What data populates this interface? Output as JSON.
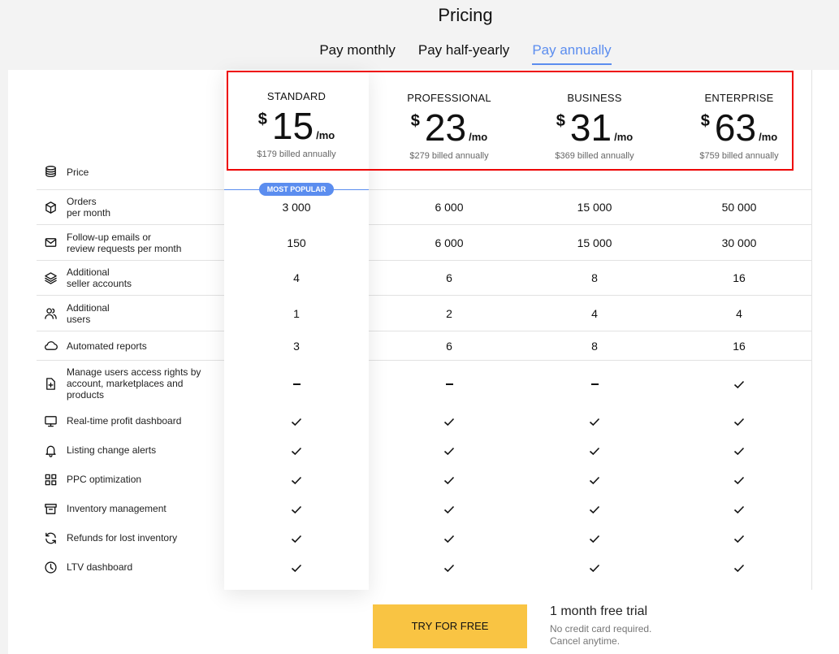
{
  "header": {
    "title": "Pricing",
    "tabs": [
      {
        "label": "Pay monthly",
        "active": false
      },
      {
        "label": "Pay half-yearly",
        "active": false
      },
      {
        "label": "Pay annually",
        "active": true
      }
    ]
  },
  "colors": {
    "accent": "#5b8def",
    "cta": "#f9c443",
    "highlight_border": "#ee0000"
  },
  "plans": [
    {
      "name": "STANDARD",
      "currency": "$",
      "price": "15",
      "per": "/mo",
      "billed": "$179 billed annually",
      "badge": "MOST POPULAR"
    },
    {
      "name": "PROFESSIONAL",
      "currency": "$",
      "price": "23",
      "per": "/mo",
      "billed": "$279 billed annually"
    },
    {
      "name": "BUSINESS",
      "currency": "$",
      "price": "31",
      "per": "/mo",
      "billed": "$369 billed annually"
    },
    {
      "name": "ENTERPRISE",
      "currency": "$",
      "price": "63",
      "per": "/mo",
      "billed": "$759 billed annually"
    }
  ],
  "features": [
    {
      "icon": "coins-icon",
      "label": "Price",
      "values": []
    },
    {
      "icon": "box-icon",
      "label": "Orders\nper month",
      "values": [
        "3 000",
        "6 000",
        "15 000",
        "50 000"
      ]
    },
    {
      "icon": "mail-icon",
      "label": "Follow-up emails or\nreview requests per month",
      "values": [
        "150",
        "6 000",
        "15 000",
        "30 000"
      ]
    },
    {
      "icon": "layers-icon",
      "label": "Additional\nseller accounts",
      "values": [
        "4",
        "6",
        "8",
        "16"
      ]
    },
    {
      "icon": "users-icon",
      "label": "Additional\nusers",
      "values": [
        "1",
        "2",
        "4",
        "4"
      ]
    },
    {
      "icon": "cloud-icon",
      "label": "Automated reports",
      "values": [
        "3",
        "6",
        "8",
        "16"
      ]
    },
    {
      "icon": "file-plus-icon",
      "label": "Manage users access rights by\naccount, marketplaces and\nproducts",
      "values": [
        "no",
        "no",
        "no",
        "yes"
      ]
    },
    {
      "icon": "monitor-icon",
      "label": "Real-time profit dashboard",
      "values": [
        "yes",
        "yes",
        "yes",
        "yes"
      ]
    },
    {
      "icon": "bell-icon",
      "label": "Listing change alerts",
      "values": [
        "yes",
        "yes",
        "yes",
        "yes"
      ]
    },
    {
      "icon": "grid-icon",
      "label": "PPC optimization",
      "values": [
        "yes",
        "yes",
        "yes",
        "yes"
      ]
    },
    {
      "icon": "archive-icon",
      "label": "Inventory management",
      "values": [
        "yes",
        "yes",
        "yes",
        "yes"
      ]
    },
    {
      "icon": "refresh-icon",
      "label": "Refunds for lost inventory",
      "values": [
        "yes",
        "yes",
        "yes",
        "yes"
      ]
    },
    {
      "icon": "clock-icon",
      "label": "LTV dashboard",
      "values": [
        "yes",
        "yes",
        "yes",
        "yes"
      ]
    }
  ],
  "cta": {
    "button_label": "TRY FOR FREE",
    "trial_title": "1 month free trial",
    "trial_line1": "No credit card required.",
    "trial_line2": "Cancel anytime."
  }
}
